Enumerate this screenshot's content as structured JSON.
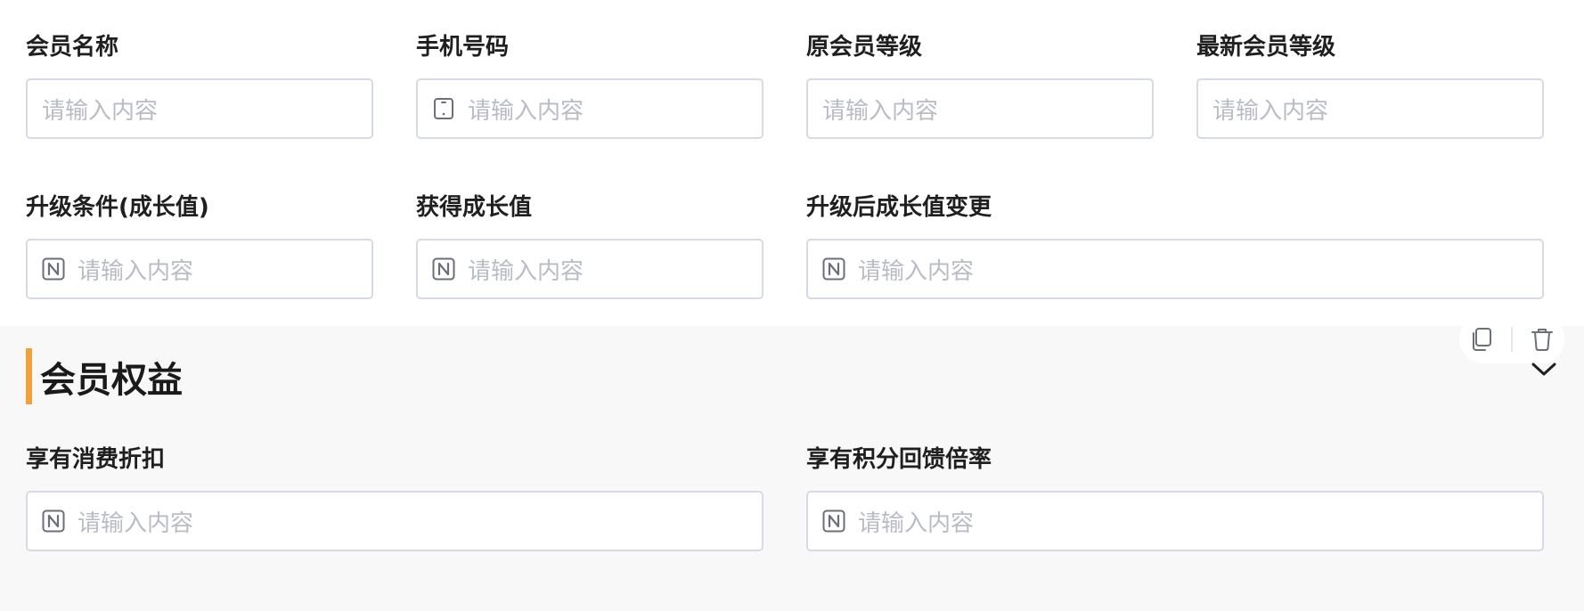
{
  "basic_fields": [
    {
      "label": "会员名称",
      "placeholder": "请输入内容",
      "icon": "none"
    },
    {
      "label": "手机号码",
      "placeholder": "请输入内容",
      "icon": "phone-icon"
    },
    {
      "label": "原会员等级",
      "placeholder": "请输入内容",
      "icon": "none"
    },
    {
      "label": "最新会员等级",
      "placeholder": "请输入内容",
      "icon": "none"
    },
    {
      "label": "升级条件(成长值)",
      "placeholder": "请输入内容",
      "icon": "number-icon"
    },
    {
      "label": "获得成长值",
      "placeholder": "请输入内容",
      "icon": "number-icon"
    },
    {
      "label": "升级后成长值变更",
      "placeholder": "请输入内容",
      "icon": "number-icon"
    }
  ],
  "benefits_section": {
    "title": "会员权益",
    "accent_color": "#f5a13a",
    "fields": [
      {
        "label": "享有消费折扣",
        "placeholder": "请输入内容",
        "icon": "number-icon"
      },
      {
        "label": "享有积分回馈倍率",
        "placeholder": "请输入内容",
        "icon": "number-icon"
      }
    ],
    "toolbar": {
      "copy_icon": "copy-icon",
      "delete_icon": "trash-icon"
    },
    "collapse_icon": "chevron-down-icon"
  }
}
